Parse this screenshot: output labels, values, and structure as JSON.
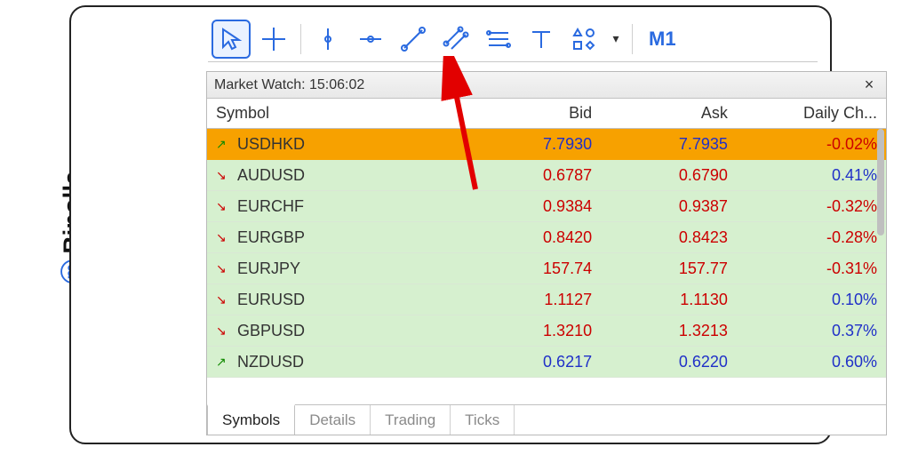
{
  "brand": "Binolla",
  "toolbar": {
    "timeframe": "M1"
  },
  "panel": {
    "title": "Market Watch: 15:06:02",
    "columns": {
      "symbol": "Symbol",
      "bid": "Bid",
      "ask": "Ask",
      "daily": "Daily Ch..."
    },
    "rows": [
      {
        "dir": "up",
        "symbol": "USDHKD",
        "bid": "7.7930",
        "ask": "7.7935",
        "chg": "-0.02%",
        "sel": true,
        "bidc": "blue",
        "askc": "blue",
        "chgc": "red"
      },
      {
        "dir": "down",
        "symbol": "AUDUSD",
        "bid": "0.6787",
        "ask": "0.6790",
        "chg": "0.41%",
        "sel": false,
        "bidc": "red",
        "askc": "red",
        "chgc": "blue"
      },
      {
        "dir": "down",
        "symbol": "EURCHF",
        "bid": "0.9384",
        "ask": "0.9387",
        "chg": "-0.32%",
        "sel": false,
        "bidc": "red",
        "askc": "red",
        "chgc": "red"
      },
      {
        "dir": "down",
        "symbol": "EURGBP",
        "bid": "0.8420",
        "ask": "0.8423",
        "chg": "-0.28%",
        "sel": false,
        "bidc": "red",
        "askc": "red",
        "chgc": "red"
      },
      {
        "dir": "down",
        "symbol": "EURJPY",
        "bid": "157.74",
        "ask": "157.77",
        "chg": "-0.31%",
        "sel": false,
        "bidc": "red",
        "askc": "red",
        "chgc": "red"
      },
      {
        "dir": "down",
        "symbol": "EURUSD",
        "bid": "1.1127",
        "ask": "1.1130",
        "chg": "0.10%",
        "sel": false,
        "bidc": "red",
        "askc": "red",
        "chgc": "blue"
      },
      {
        "dir": "down",
        "symbol": "GBPUSD",
        "bid": "1.3210",
        "ask": "1.3213",
        "chg": "0.37%",
        "sel": false,
        "bidc": "red",
        "askc": "red",
        "chgc": "blue"
      },
      {
        "dir": "up",
        "symbol": "NZDUSD",
        "bid": "0.6217",
        "ask": "0.6220",
        "chg": "0.60%",
        "sel": false,
        "bidc": "blue",
        "askc": "blue",
        "chgc": "blue"
      }
    ],
    "tabs": [
      {
        "label": "Symbols",
        "active": true
      },
      {
        "label": "Details",
        "active": false
      },
      {
        "label": "Trading",
        "active": false
      },
      {
        "label": "Ticks",
        "active": false
      }
    ]
  }
}
